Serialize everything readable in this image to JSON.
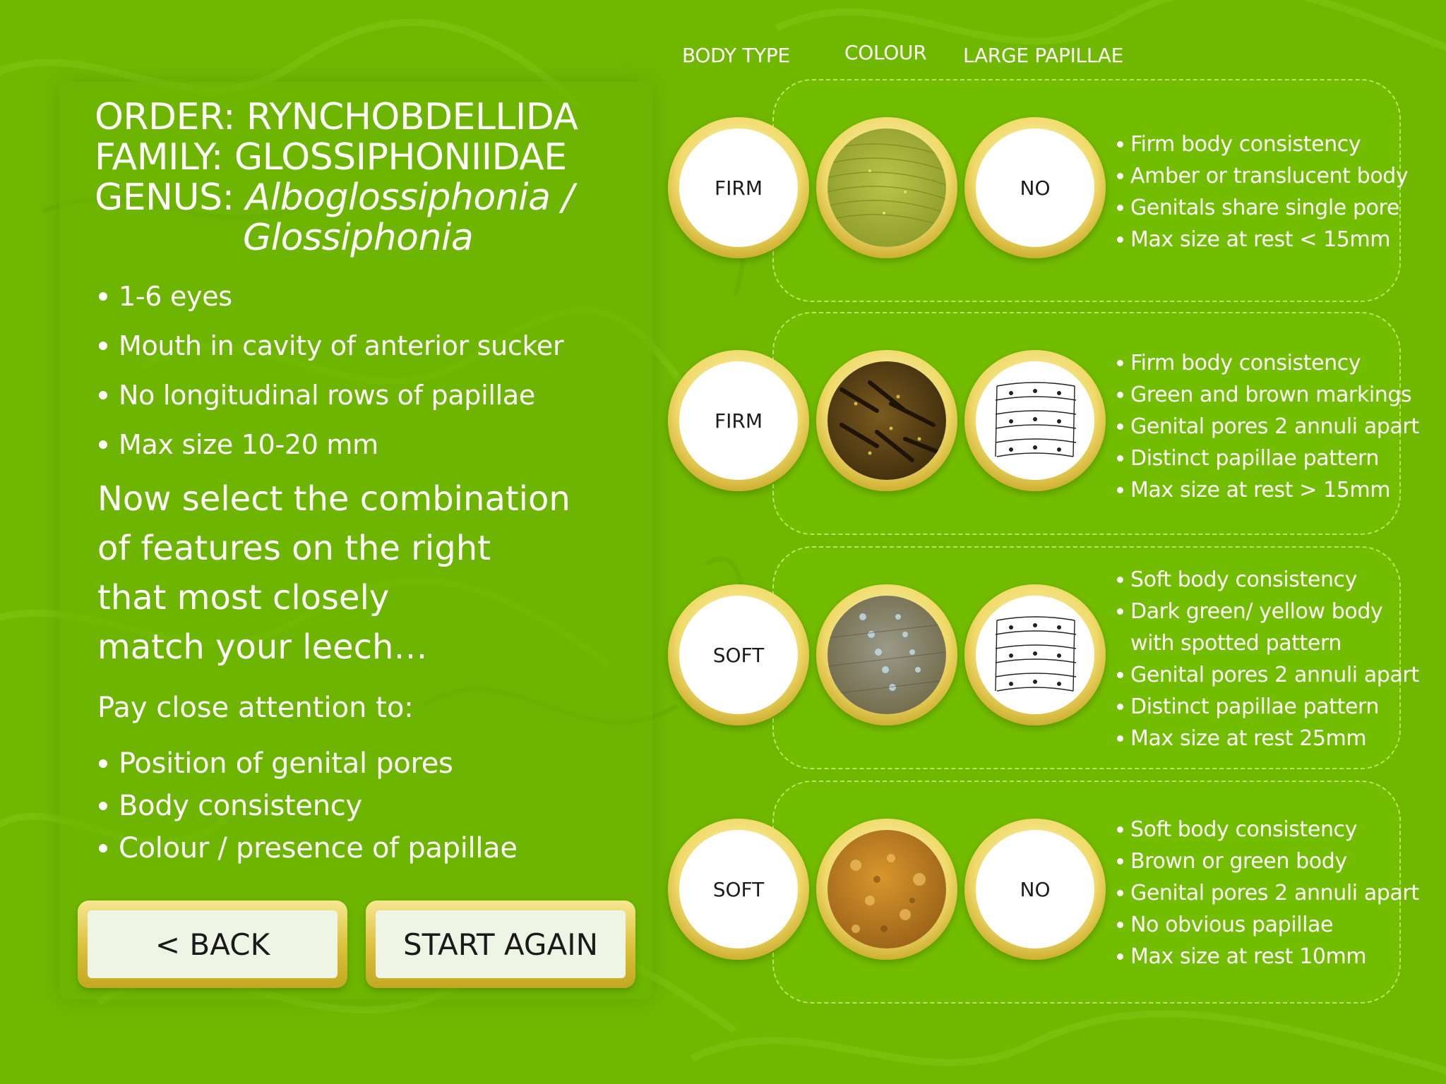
{
  "taxonomy": {
    "order": "ORDER: RYNCHOBDELLIDA",
    "family": "FAMILY: GLOSSIPHONIIDAE",
    "genus_prefix": "GENUS: ",
    "genus_name_1": "Alboglossiphonia /",
    "genus_name_2": "Glossiphonia"
  },
  "traits": [
    "1-6 eyes",
    "Mouth in cavity of anterior sucker",
    "No longitudinal rows of papillae",
    "Max size 10-20 mm"
  ],
  "instruction": [
    "Now select the combination",
    "of features on the right",
    "that most closely",
    "match your leech…"
  ],
  "attention": {
    "heading": "Pay close attention to:",
    "items": [
      "Position of genital pores",
      "Body consistency",
      "Colour / presence of papillae"
    ]
  },
  "buttons": {
    "back": "< BACK",
    "start_again": "START AGAIN"
  },
  "columns": {
    "body_type": "BODY TYPE",
    "colour": "COLOUR",
    "large_papillae": "LARGE PAPILLAE"
  },
  "options": [
    {
      "body_type": "FIRM",
      "colour_icon": "pale-green-texture-icon",
      "papillae": "NO",
      "papillae_icon": "",
      "features": [
        "Firm body consistency",
        "Amber or translucent body",
        "Genitals share single pore",
        "Max size at rest < 15mm"
      ]
    },
    {
      "body_type": "FIRM",
      "colour_icon": "brown-markings-texture-icon",
      "papillae": "",
      "papillae_icon": "papillae-diagram-icon",
      "features": [
        "Firm body consistency",
        "Green and brown markings",
        "Genital pores 2 annuli apart",
        "Distinct papillae pattern",
        "Max size at rest > 15mm"
      ]
    },
    {
      "body_type": "SOFT",
      "colour_icon": "spotted-grey-texture-icon",
      "papillae": "",
      "papillae_icon": "papillae-diagram-icon",
      "features": [
        "Soft body consistency",
        "Dark green/ yellow body",
        "with spotted pattern",
        "Genital pores 2 annuli apart",
        "Distinct papillae pattern",
        "Max size at rest 25mm"
      ]
    },
    {
      "body_type": "SOFT",
      "colour_icon": "orange-brown-texture-icon",
      "papillae": "NO",
      "papillae_icon": "",
      "features": [
        "Soft body consistency",
        "Brown or green body",
        "Genital pores 2 annuli apart",
        "No obvious papillae",
        "Max size at rest 10mm"
      ]
    }
  ],
  "colors": {
    "background": "#70b800",
    "button_gold": "#d9bf3a",
    "button_face": "#eef5e4"
  }
}
